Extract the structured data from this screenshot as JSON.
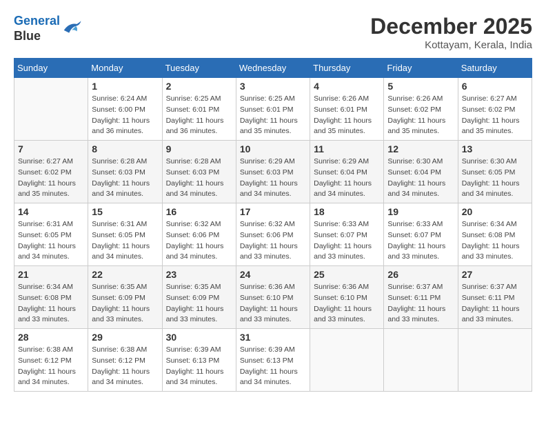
{
  "header": {
    "logo_line1": "General",
    "logo_line2": "Blue",
    "month": "December 2025",
    "location": "Kottayam, Kerala, India"
  },
  "weekdays": [
    "Sunday",
    "Monday",
    "Tuesday",
    "Wednesday",
    "Thursday",
    "Friday",
    "Saturday"
  ],
  "weeks": [
    [
      {
        "day": "",
        "info": ""
      },
      {
        "day": "1",
        "info": "Sunrise: 6:24 AM\nSunset: 6:00 PM\nDaylight: 11 hours\nand 36 minutes."
      },
      {
        "day": "2",
        "info": "Sunrise: 6:25 AM\nSunset: 6:01 PM\nDaylight: 11 hours\nand 36 minutes."
      },
      {
        "day": "3",
        "info": "Sunrise: 6:25 AM\nSunset: 6:01 PM\nDaylight: 11 hours\nand 35 minutes."
      },
      {
        "day": "4",
        "info": "Sunrise: 6:26 AM\nSunset: 6:01 PM\nDaylight: 11 hours\nand 35 minutes."
      },
      {
        "day": "5",
        "info": "Sunrise: 6:26 AM\nSunset: 6:02 PM\nDaylight: 11 hours\nand 35 minutes."
      },
      {
        "day": "6",
        "info": "Sunrise: 6:27 AM\nSunset: 6:02 PM\nDaylight: 11 hours\nand 35 minutes."
      }
    ],
    [
      {
        "day": "7",
        "info": "Sunrise: 6:27 AM\nSunset: 6:02 PM\nDaylight: 11 hours\nand 35 minutes."
      },
      {
        "day": "8",
        "info": "Sunrise: 6:28 AM\nSunset: 6:03 PM\nDaylight: 11 hours\nand 34 minutes."
      },
      {
        "day": "9",
        "info": "Sunrise: 6:28 AM\nSunset: 6:03 PM\nDaylight: 11 hours\nand 34 minutes."
      },
      {
        "day": "10",
        "info": "Sunrise: 6:29 AM\nSunset: 6:03 PM\nDaylight: 11 hours\nand 34 minutes."
      },
      {
        "day": "11",
        "info": "Sunrise: 6:29 AM\nSunset: 6:04 PM\nDaylight: 11 hours\nand 34 minutes."
      },
      {
        "day": "12",
        "info": "Sunrise: 6:30 AM\nSunset: 6:04 PM\nDaylight: 11 hours\nand 34 minutes."
      },
      {
        "day": "13",
        "info": "Sunrise: 6:30 AM\nSunset: 6:05 PM\nDaylight: 11 hours\nand 34 minutes."
      }
    ],
    [
      {
        "day": "14",
        "info": "Sunrise: 6:31 AM\nSunset: 6:05 PM\nDaylight: 11 hours\nand 34 minutes."
      },
      {
        "day": "15",
        "info": "Sunrise: 6:31 AM\nSunset: 6:05 PM\nDaylight: 11 hours\nand 34 minutes."
      },
      {
        "day": "16",
        "info": "Sunrise: 6:32 AM\nSunset: 6:06 PM\nDaylight: 11 hours\nand 34 minutes."
      },
      {
        "day": "17",
        "info": "Sunrise: 6:32 AM\nSunset: 6:06 PM\nDaylight: 11 hours\nand 33 minutes."
      },
      {
        "day": "18",
        "info": "Sunrise: 6:33 AM\nSunset: 6:07 PM\nDaylight: 11 hours\nand 33 minutes."
      },
      {
        "day": "19",
        "info": "Sunrise: 6:33 AM\nSunset: 6:07 PM\nDaylight: 11 hours\nand 33 minutes."
      },
      {
        "day": "20",
        "info": "Sunrise: 6:34 AM\nSunset: 6:08 PM\nDaylight: 11 hours\nand 33 minutes."
      }
    ],
    [
      {
        "day": "21",
        "info": "Sunrise: 6:34 AM\nSunset: 6:08 PM\nDaylight: 11 hours\nand 33 minutes."
      },
      {
        "day": "22",
        "info": "Sunrise: 6:35 AM\nSunset: 6:09 PM\nDaylight: 11 hours\nand 33 minutes."
      },
      {
        "day": "23",
        "info": "Sunrise: 6:35 AM\nSunset: 6:09 PM\nDaylight: 11 hours\nand 33 minutes."
      },
      {
        "day": "24",
        "info": "Sunrise: 6:36 AM\nSunset: 6:10 PM\nDaylight: 11 hours\nand 33 minutes."
      },
      {
        "day": "25",
        "info": "Sunrise: 6:36 AM\nSunset: 6:10 PM\nDaylight: 11 hours\nand 33 minutes."
      },
      {
        "day": "26",
        "info": "Sunrise: 6:37 AM\nSunset: 6:11 PM\nDaylight: 11 hours\nand 33 minutes."
      },
      {
        "day": "27",
        "info": "Sunrise: 6:37 AM\nSunset: 6:11 PM\nDaylight: 11 hours\nand 33 minutes."
      }
    ],
    [
      {
        "day": "28",
        "info": "Sunrise: 6:38 AM\nSunset: 6:12 PM\nDaylight: 11 hours\nand 34 minutes."
      },
      {
        "day": "29",
        "info": "Sunrise: 6:38 AM\nSunset: 6:12 PM\nDaylight: 11 hours\nand 34 minutes."
      },
      {
        "day": "30",
        "info": "Sunrise: 6:39 AM\nSunset: 6:13 PM\nDaylight: 11 hours\nand 34 minutes."
      },
      {
        "day": "31",
        "info": "Sunrise: 6:39 AM\nSunset: 6:13 PM\nDaylight: 11 hours\nand 34 minutes."
      },
      {
        "day": "",
        "info": ""
      },
      {
        "day": "",
        "info": ""
      },
      {
        "day": "",
        "info": ""
      }
    ]
  ]
}
